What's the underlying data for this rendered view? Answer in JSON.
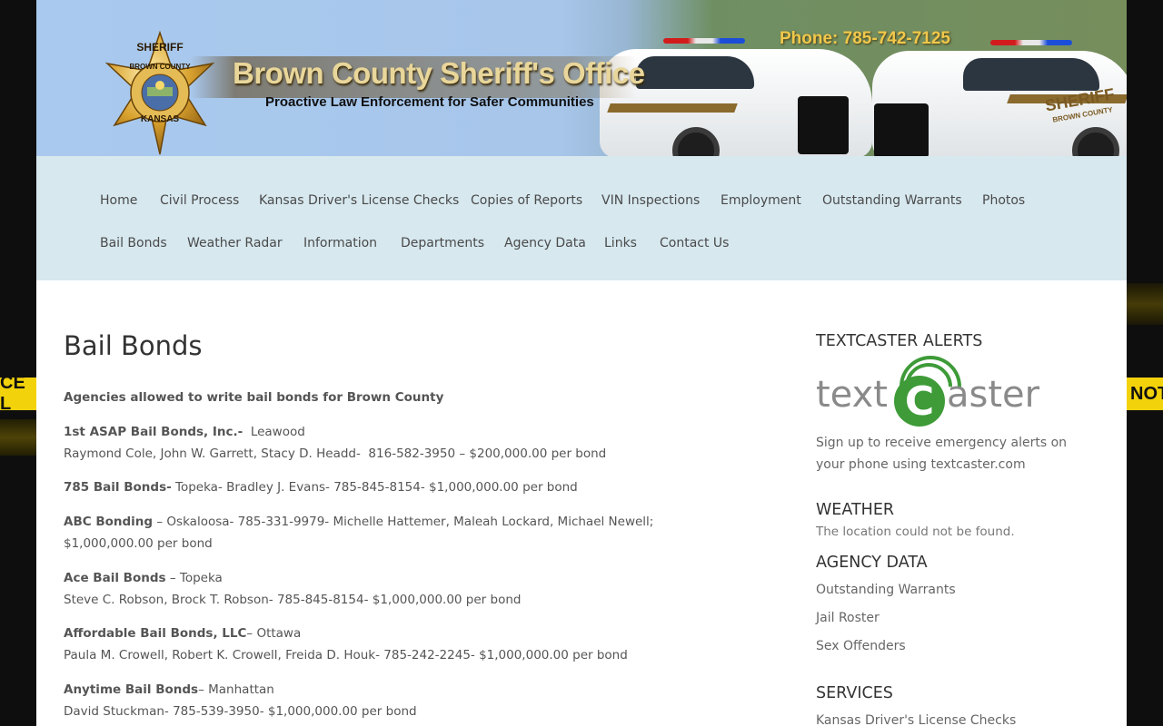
{
  "background": {
    "tape_left_text": "CE L",
    "tape_right_text": "NOT"
  },
  "header": {
    "logo": {
      "top_text": "SHERIFF",
      "arc_text": "BROWN COUNTY",
      "bottom_text": "KANSAS"
    },
    "site_title": "Brown County Sheriff's Office",
    "tagline": "Proactive Law Enforcement for Safer Communities",
    "phone": "Phone: 785-742-7125",
    "car_decal": "SHERIFF",
    "car_decal_sub": "BROWN COUNTY"
  },
  "nav": {
    "row1": [
      "Home",
      "Civil Process",
      "Kansas Driver's License Checks",
      "Copies of Reports",
      "VIN Inspections",
      "Employment",
      "Outstanding Warrants",
      "Photos"
    ],
    "row2": [
      "Bail Bonds",
      "Weather Radar",
      "Information",
      "Departments",
      "Agency Data",
      "Links",
      "Contact Us"
    ]
  },
  "main": {
    "title": "Bail Bonds",
    "intro": "Agencies allowed to write bail bonds for Brown County",
    "entries": [
      {
        "name": "1st ASAP Bail Bonds, Inc.-",
        "rest": "  Leawood",
        "line2": "Raymond Cole, John W. Garrett, Stacy D. Headd-  816-582-3950 – $200,000.00 per bond"
      },
      {
        "name": "785 Bail Bonds-",
        "rest": " Topeka- Bradley J. Evans- 785-845-8154- $1,000,000.00 per bond",
        "line2": ""
      },
      {
        "name": "ABC Bonding",
        "rest": " – Oskaloosa- 785-331-9979- Michelle Hattemer, Maleah Lockard, Michael Newell; $1,000,000.00 per bond",
        "line2": ""
      },
      {
        "name": "Ace Bail Bonds",
        "rest": " – Topeka",
        "line2": "Steve C. Robson, Brock T. Robson- 785-845-8154- $1,000,000.00 per bond"
      },
      {
        "name": "Affordable Bail Bonds, LLC",
        "rest": "– Ottawa",
        "line2": "Paula M. Crowell, Robert K. Crowell, Freida D. Houk- 785-242-2245- $1,000,000.00 per bond"
      },
      {
        "name": "Anytime Bail Bonds",
        "rest": "– Manhattan",
        "line2": "David Stuckman- 785-539-3950- $1,000,000.00 per bond"
      }
    ]
  },
  "sidebar": {
    "textcaster": {
      "title": "TEXTCASTER ALERTS",
      "logo_left": "text",
      "logo_c": "C",
      "logo_right": "aster",
      "text": "Sign up to receive emergency alerts on your phone using textcaster.com"
    },
    "weather": {
      "title": "WEATHER",
      "text": "The location could not be found."
    },
    "agency": {
      "title": "AGENCY DATA",
      "links": [
        "Outstanding Warrants",
        "Jail Roster",
        "Sex Offenders"
      ]
    },
    "services": {
      "title": "SERVICES",
      "links": [
        "Kansas Driver's License Checks"
      ]
    }
  },
  "colors": {
    "nav_bg": "#d7e8ef",
    "phone": "#f1c84b",
    "textcaster_green": "#3e9b38",
    "tape": "#f2d20a"
  }
}
